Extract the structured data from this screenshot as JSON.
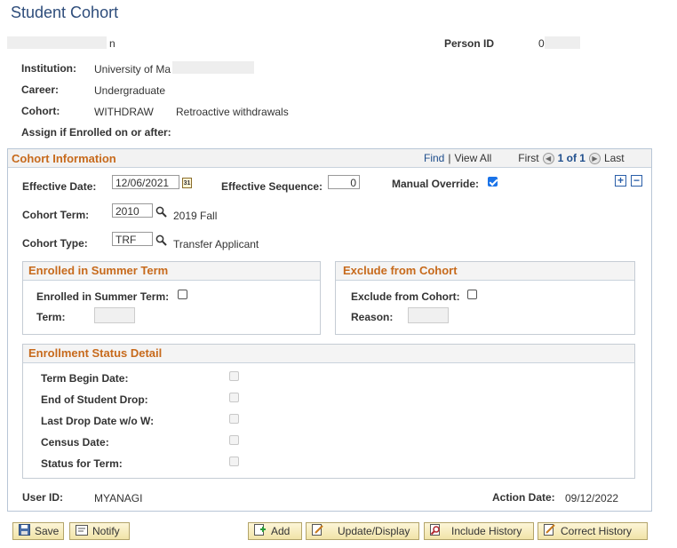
{
  "page": {
    "title": "Student Cohort"
  },
  "header": {
    "name_suffix": "n",
    "person_id_label": "Person ID",
    "person_id_prefix": "0"
  },
  "details": {
    "institution_label": "Institution:",
    "institution_value": "University of Ma",
    "career_label": "Career:",
    "career_value": "Undergraduate",
    "cohort_label": "Cohort:",
    "cohort_code": "WITHDRAW",
    "cohort_desc": "Retroactive withdrawals",
    "assign_label": "Assign if Enrolled on or after:"
  },
  "cohort_info": {
    "title": "Cohort Information",
    "find": "Find",
    "separator": "|",
    "view_all": "View All",
    "first": "First",
    "counter": "1 of 1",
    "last": "Last",
    "effective_date_label": "Effective Date:",
    "effective_date_value": "12/06/2021",
    "calendar_icon_text": "31",
    "effective_seq_label": "Effective Sequence:",
    "effective_seq_value": "0",
    "manual_override_label": "Manual Override:",
    "manual_override_checked": true,
    "cohort_term_label": "Cohort Term:",
    "cohort_term_value": "2010",
    "cohort_term_desc": "2019 Fall",
    "cohort_type_label": "Cohort Type:",
    "cohort_type_value": "TRF",
    "cohort_type_desc": "Transfer Applicant",
    "add_row": "+",
    "delete_row": "−"
  },
  "summer": {
    "title": "Enrolled in Summer Term",
    "enrolled_label": "Enrolled in Summer Term:",
    "term_label": "Term:"
  },
  "exclude": {
    "title": "Exclude from Cohort",
    "exclude_label": "Exclude from Cohort:",
    "reason_label": "Reason:"
  },
  "enrollment_status": {
    "title": "Enrollment Status Detail",
    "rows": [
      "Term Begin Date:",
      "End of Student Drop:",
      "Last Drop Date w/o W:",
      "Census Date:",
      "Status for Term:"
    ]
  },
  "footer_info": {
    "user_id_label": "User ID:",
    "user_id_value": "MYANAGI",
    "action_date_label": "Action Date:",
    "action_date_value": "09/12/2022"
  },
  "buttons": {
    "save": "Save",
    "notify": "Notify",
    "add": "Add",
    "update_display": "Update/Display",
    "include_history": "Include History",
    "correct_history": "Correct History"
  },
  "colors": {
    "title_blue": "#2e4d7b",
    "section_orange": "#c76a1c",
    "link_blue": "#1f4e8c",
    "check_blue": "#1a73e8"
  }
}
